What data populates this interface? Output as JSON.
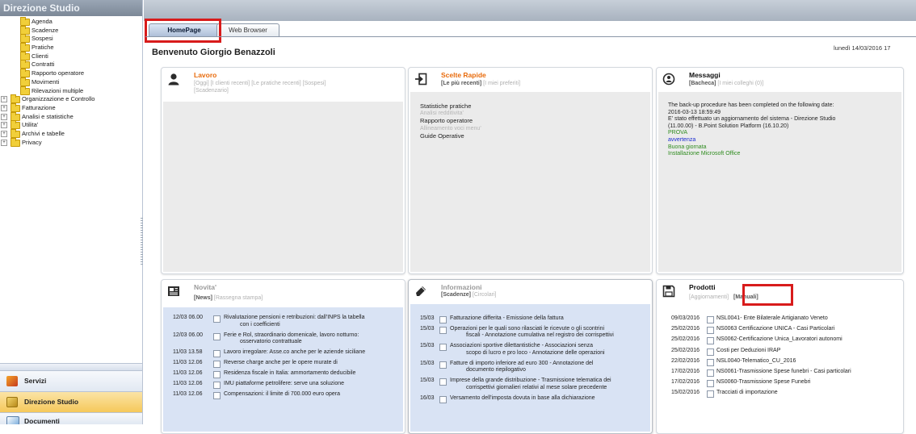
{
  "sidebar": {
    "title": "Direzione Studio",
    "tree": [
      {
        "label": "Agenda",
        "expandable": false
      },
      {
        "label": "Scadenze",
        "expandable": false
      },
      {
        "label": "Sospesi",
        "expandable": false
      },
      {
        "label": "Pratiche",
        "expandable": false
      },
      {
        "label": "Clienti",
        "expandable": false
      },
      {
        "label": "Contratti",
        "expandable": false
      },
      {
        "label": "Rapporto operatore",
        "expandable": false
      },
      {
        "label": "Movimenti",
        "expandable": false
      },
      {
        "label": "Rilevazioni multiple",
        "expandable": false
      },
      {
        "label": "Organizzazione e Controllo",
        "expandable": true
      },
      {
        "label": "Fatturazione",
        "expandable": true
      },
      {
        "label": "Analisi e statistiche",
        "expandable": true
      },
      {
        "label": "Utilita'",
        "expandable": true
      },
      {
        "label": "Archivi e tabelle",
        "expandable": true
      },
      {
        "label": "Privacy",
        "expandable": true
      }
    ],
    "bottom_nav": [
      {
        "label": "Servizi",
        "icon": "services-icon",
        "active": false
      },
      {
        "label": "Direzione Studio",
        "icon": "direction-icon",
        "active": true
      },
      {
        "label": "Documenti",
        "icon": "documents-icon",
        "active": false
      }
    ]
  },
  "tabs": [
    {
      "label": "HomePage",
      "active": true
    },
    {
      "label": "Web Browser",
      "active": false
    }
  ],
  "welcome": "Benvenuto Giorgio Benazzoli",
  "date": "lunedì 14/03/2016 17",
  "panels": {
    "lavoro": {
      "title": "Lavoro",
      "links_line1": "[Oggi] [I clienti recenti] [Le pratiche recenti] [Sospesi]",
      "links_line2": "[Scadenzario]"
    },
    "scelte": {
      "title": "Scelte Rapide",
      "links_bold": "[Le più recenti]",
      "links_rest": " [I miei preferiti]",
      "items": [
        {
          "text": "Statistiche pratiche",
          "disabled": false
        },
        {
          "text": "Analisi redditivita'",
          "disabled": true
        },
        {
          "text": "Rapporto operatore",
          "disabled": false
        },
        {
          "text": "Allineamento voci menu'",
          "disabled": true
        },
        {
          "text": "Guide Operative",
          "disabled": false
        }
      ]
    },
    "messaggi": {
      "title": "Messaggi",
      "links_bold": "[Bacheca]",
      "links_rest": " [I miei colleghi (0)]",
      "lines": [
        {
          "text": "The back-up procedure has been completed on the following date:",
          "color": "#222222"
        },
        {
          "text": "2016-03-13 18:59:49",
          "color": "#222222"
        },
        {
          "text": "E' stato effettuato un aggiornamento del sistema  - Direzione Studio",
          "color": "#222222"
        },
        {
          "text": "(11.00.00) - B.Point Solution Platform (16.10.20)",
          "color": "#222222"
        },
        {
          "text": "PROVA",
          "color": "#2e8b1e"
        },
        {
          "text": "avvertenza",
          "color": "#1a2bd0"
        },
        {
          "text": "Buona giornata",
          "color": "#2e8b1e"
        },
        {
          "text": "Installazione Microsoft Office",
          "color": "#2e8b1e"
        }
      ]
    },
    "novita": {
      "title": "Novita'",
      "links_bold": "[News]",
      "links_rest": " [Rassegna stampa]",
      "rows": [
        {
          "date": "12/03 06.00",
          "lines": [
            "Rivalutazione pensioni e retribuzioni: dall'INPS la tabella",
            "con i coefficienti"
          ]
        },
        {
          "date": "12/03 06.00",
          "lines": [
            "Ferie e Rol, straordinario domenicale, lavoro notturno:",
            "osservatorio contrattuale"
          ]
        },
        {
          "date": "11/03 13.58",
          "lines": [
            "Lavoro irregolare: Asse.co anche per le aziende siciliane"
          ]
        },
        {
          "date": "11/03 12.06",
          "lines": [
            "Reverse charge anche per le opere murate di"
          ]
        },
        {
          "date": "11/03 12.06",
          "lines": [
            "Residenza fiscale in Italia: ammortamento deducibile"
          ]
        },
        {
          "date": "11/03 12.06",
          "lines": [
            "IMU piattaforme petrolifere: serve una soluzione"
          ]
        },
        {
          "date": "11/03 12.06",
          "lines": [
            "Compensazioni: il limite di 700.000 euro opera"
          ]
        }
      ]
    },
    "informazioni": {
      "title": "Informazioni",
      "links_bold": "[Scadenze]",
      "links_rest": " [Circolari]",
      "rows": [
        {
          "date": "15/03",
          "lines": [
            "Fatturazione differita - Emissione della fattura"
          ]
        },
        {
          "date": "15/03",
          "lines": [
            "Operazioni per le quali sono rilasciati le ricevute o gli scontrini",
            "fiscali - Annotazione cumulativa nel registro dei corrispettivi"
          ]
        },
        {
          "date": "15/03",
          "lines": [
            "Associazioni sportive dilettantistiche - Associazioni senza",
            "scopo di lucro e pro loco - Annotazione delle operazioni"
          ]
        },
        {
          "date": "15/03",
          "lines": [
            "Fatture di importo inferiore ad euro 300 - Annotazione del",
            "documento riepilogativo"
          ]
        },
        {
          "date": "15/03",
          "lines": [
            "Imprese della grande distribuzione - Trasmissione telematica dei",
            "corrispettivi giornalieri relativi al mese solare precedente"
          ]
        },
        {
          "date": "16/03",
          "lines": [
            "Versamento dell'imposta dovuta in base alla dichiarazione"
          ]
        }
      ]
    },
    "prodotti": {
      "title": "Prodotti",
      "link_aggiornamenti": "[Aggiornamenti]",
      "link_manuali": "[Manuali]",
      "rows": [
        {
          "date": "09/03/2016",
          "text": "NSL0041- Ente Bilaterale Artigianato Veneto"
        },
        {
          "date": "25/02/2016",
          "text": "NS0063 Certificazione UNICA - Casi Particolari"
        },
        {
          "date": "25/02/2016",
          "text": "NS0062-Certificazione Unica_Lavoratori autonomi"
        },
        {
          "date": "25/02/2016",
          "text": "Costi per Deduzioni IRAP"
        },
        {
          "date": "22/02/2016",
          "text": "NSL0040-Telematico_CU_2016"
        },
        {
          "date": "17/02/2016",
          "text": "NS0061-Trasmissione Spese funebri - Casi particolari"
        },
        {
          "date": "17/02/2016",
          "text": "NS0060-Trasmissione Spese Funebri"
        },
        {
          "date": "15/02/2016",
          "text": "Tracciati di importazione"
        }
      ]
    }
  },
  "colors": {
    "highlight": "#d81b1b",
    "panel_body": "#ebebeb",
    "news_body": "#d9e3f4",
    "orange_title": "#e86b0c"
  }
}
